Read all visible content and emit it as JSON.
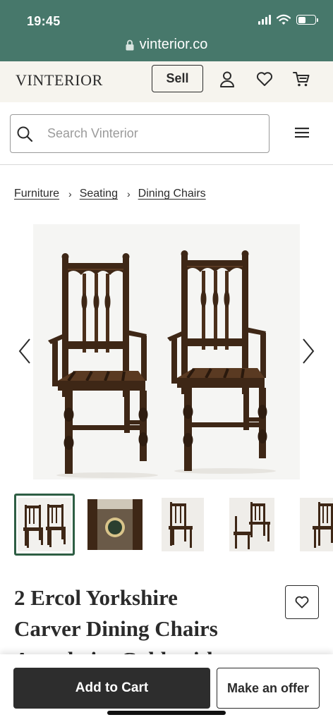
{
  "status_bar": {
    "time": "19:45",
    "icons": [
      "signal-icon",
      "wifi-icon",
      "battery-icon"
    ],
    "battery_level": 0.45
  },
  "browser": {
    "url": "vinterior.co",
    "icon": "lock-icon"
  },
  "header": {
    "logo": "VINTERIOR",
    "sell_label": "Sell",
    "icons": [
      "user-icon",
      "heart-icon",
      "cart-icon"
    ]
  },
  "search": {
    "placeholder": "Search Vinterior",
    "value": "",
    "icon": "search-icon",
    "menu_icon": "hamburger-menu-icon"
  },
  "breadcrumb": [
    {
      "label": "Furniture"
    },
    {
      "label": "Seating"
    },
    {
      "label": "Dining Chairs"
    }
  ],
  "gallery": {
    "main_image": "pair-of-carver-dining-chairs",
    "arrows": [
      "chevron-left-icon",
      "chevron-right-icon"
    ],
    "thumbnails": [
      {
        "name": "thumb-pair-front",
        "active": true
      },
      {
        "name": "thumb-maker-label",
        "active": false
      },
      {
        "name": "thumb-single-chair",
        "active": false
      },
      {
        "name": "thumb-pair-angle",
        "active": false
      },
      {
        "name": "thumb-single-side",
        "active": false
      }
    ]
  },
  "product": {
    "title_line1": "2 Ercol Yorkshire",
    "title_line2": "Carver Dining Chairs",
    "title_line3": "Armchairs Goldsmith"
  },
  "actions": {
    "add_to_cart": "Add to Cart",
    "make_offer": "Make an offer"
  },
  "colors": {
    "brand_green": "#47786b",
    "header_bg": "#f6f4ee",
    "active_thumb_border": "#2e5e44",
    "cart_button": "#2d2d2d",
    "wood": "#3e2716"
  }
}
